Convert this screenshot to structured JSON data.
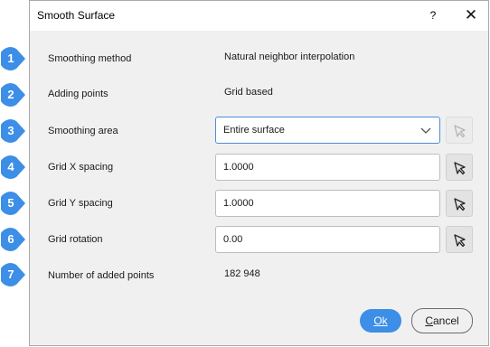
{
  "dialog": {
    "title": "Smooth Surface",
    "help_label": "?",
    "close_label": "✕"
  },
  "rows": [
    {
      "number": "1",
      "label": "Smoothing method",
      "value": "Natural neighbor interpolation"
    },
    {
      "number": "2",
      "label": "Adding points",
      "value": "Grid based"
    },
    {
      "number": "3",
      "label": "Smoothing area",
      "value": "Entire surface"
    },
    {
      "number": "4",
      "label": "Grid X spacing",
      "value": "1.0000"
    },
    {
      "number": "5",
      "label": "Grid Y spacing",
      "value": "1.0000"
    },
    {
      "number": "6",
      "label": "Grid rotation",
      "value": "0.00"
    },
    {
      "number": "7",
      "label": "Number of added points",
      "value": "182 948"
    }
  ],
  "buttons": {
    "ok_label": "Ok",
    "cancel_label_first": "C",
    "cancel_label_rest": "ancel"
  },
  "colors": {
    "badge": "#3c8ee6",
    "accent": "#3c8ee6"
  },
  "icons": {
    "pick": "cursor-arrow-icon",
    "dropdown": "chevron-down-icon"
  }
}
